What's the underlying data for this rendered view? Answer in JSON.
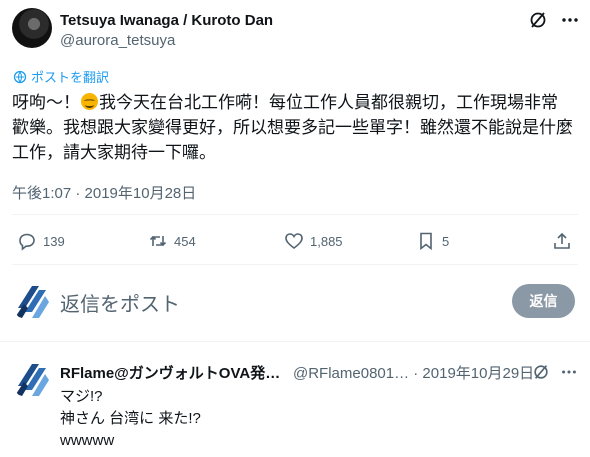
{
  "tweet": {
    "author_name": "Tetsuya Iwanaga / Kuroto Dan",
    "author_handle": "@aurora_tetsuya",
    "translate_label": "ポストを翻訳",
    "text_line1_a": "呀呴～！",
    "text_line1_b": "我今天在台北工作嗬！每位工作人員都很親切，工作現場非常",
    "text_line2": "歡樂。我想跟大家變得更好，所以想要多記一些單字！雖然還不能說是什麼",
    "text_line3": "工作，請大家期待一下囉。",
    "emoji": "smiling-face-emoji",
    "timestamp": "午後1:07 · 2019年10月28日"
  },
  "actions": {
    "replies": "139",
    "retweets": "454",
    "likes": "1,885",
    "bookmarks": "5"
  },
  "reply_box": {
    "placeholder": "返信をポスト",
    "button_label": "返信"
  },
  "reply": {
    "author_name": "RFlame@ガンヴォルトOVA発…",
    "meta": "@RFlame0801… · 2019年10月29日",
    "lines": [
      "マジ!?",
      "神さん 台湾に 来た!?",
      "wwwww"
    ]
  },
  "colors": {
    "accent": "#1d9bf0",
    "muted": "#536471",
    "reply_button_bg": "#8b98a5",
    "divider": "#eff3f4"
  }
}
